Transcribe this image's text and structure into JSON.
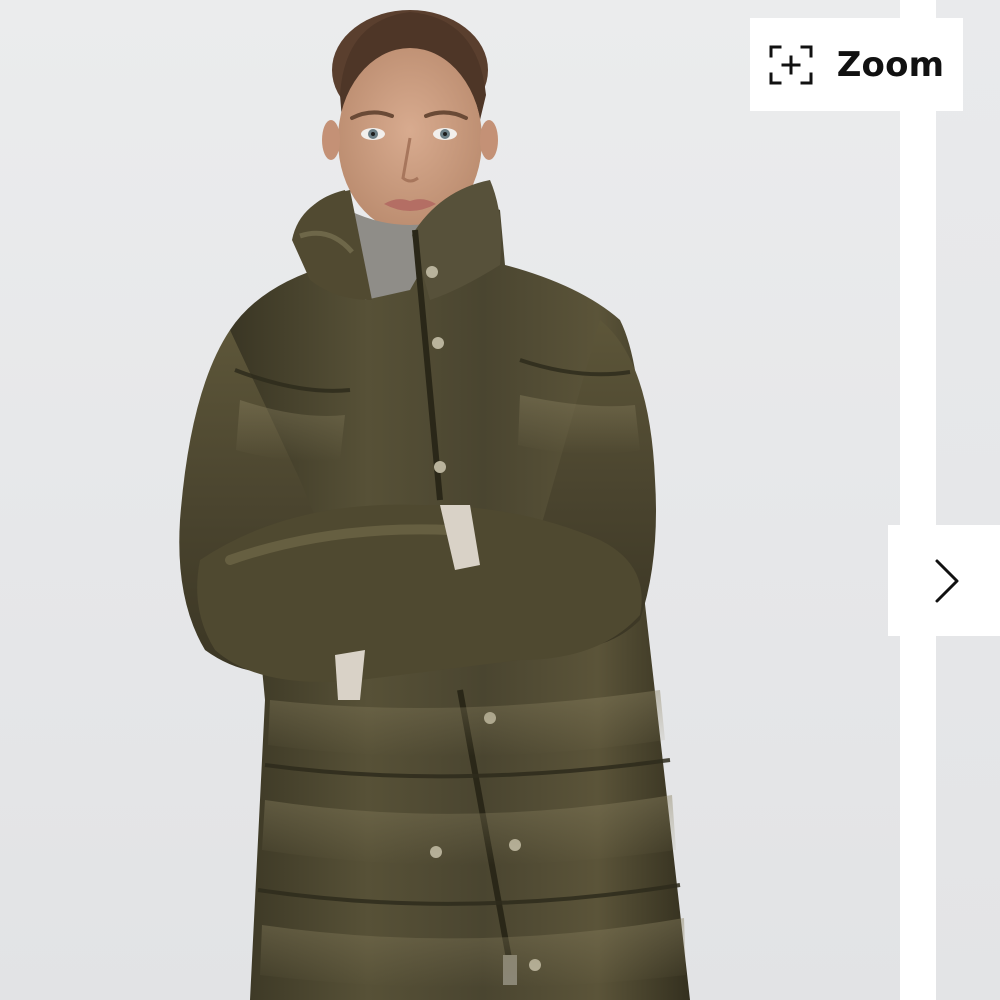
{
  "viewer": {
    "zoom_button": {
      "label": "Zoom",
      "icon": "expand-plus-icon"
    },
    "next_button": {
      "icon": "chevron-right-icon"
    },
    "photo": {
      "subject": "model-wearing-olive-quilted-faux-leather-puffer-coat"
    }
  },
  "colors": {
    "background": "#e9eaec",
    "coat": "#4a4530",
    "coat_highlight": "#6e6648",
    "button_bg": "#ffffff",
    "text": "#111111"
  }
}
